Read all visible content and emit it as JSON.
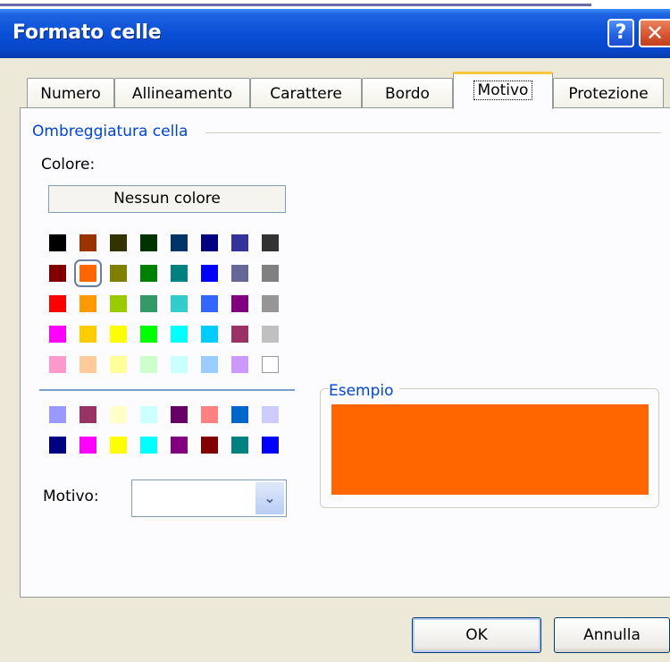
{
  "window": {
    "title": "Formato celle",
    "help_glyph": "?",
    "close_glyph": "✕"
  },
  "tabs": [
    {
      "label": "Numero"
    },
    {
      "label": "Allineamento"
    },
    {
      "label": "Carattere"
    },
    {
      "label": "Bordo"
    },
    {
      "label": "Motivo",
      "active": true
    },
    {
      "label": "Protezione"
    }
  ],
  "shading": {
    "group_label": "Ombreggiatura cella",
    "color_label": "Colore:",
    "no_color_button": "Nessun colore",
    "selected_color": "#ff6600",
    "palette_main": [
      [
        "#000000",
        "#993300",
        "#333300",
        "#003300",
        "#003366",
        "#000080",
        "#333399",
        "#333333"
      ],
      [
        "#800000",
        "#ff6600",
        "#808000",
        "#008000",
        "#008080",
        "#0000ff",
        "#666699",
        "#808080"
      ],
      [
        "#ff0000",
        "#ff9900",
        "#99cc00",
        "#339966",
        "#33cccc",
        "#3366ff",
        "#800080",
        "#969696"
      ],
      [
        "#ff00ff",
        "#ffcc00",
        "#ffff00",
        "#00ff00",
        "#00ffff",
        "#00ccff",
        "#993366",
        "#c0c0c0"
      ],
      [
        "#ff99cc",
        "#ffcc99",
        "#ffff99",
        "#ccffcc",
        "#ccffff",
        "#99ccff",
        "#cc99ff",
        "#ffffff"
      ]
    ],
    "palette_extra": [
      [
        "#9999ff",
        "#993366",
        "#ffffcc",
        "#ccffff",
        "#660066",
        "#ff8080",
        "#0066cc",
        "#ccccff"
      ],
      [
        "#000080",
        "#ff00ff",
        "#ffff00",
        "#00ffff",
        "#800080",
        "#800000",
        "#008080",
        "#0000ff"
      ]
    ],
    "pattern_label": "Motivo:",
    "pattern_value": "",
    "pattern_dropdown_icon": "chevron-down-icon"
  },
  "example": {
    "label": "Esempio",
    "color": "#ff6600"
  },
  "buttons": {
    "ok": "OK",
    "cancel": "Annulla"
  }
}
